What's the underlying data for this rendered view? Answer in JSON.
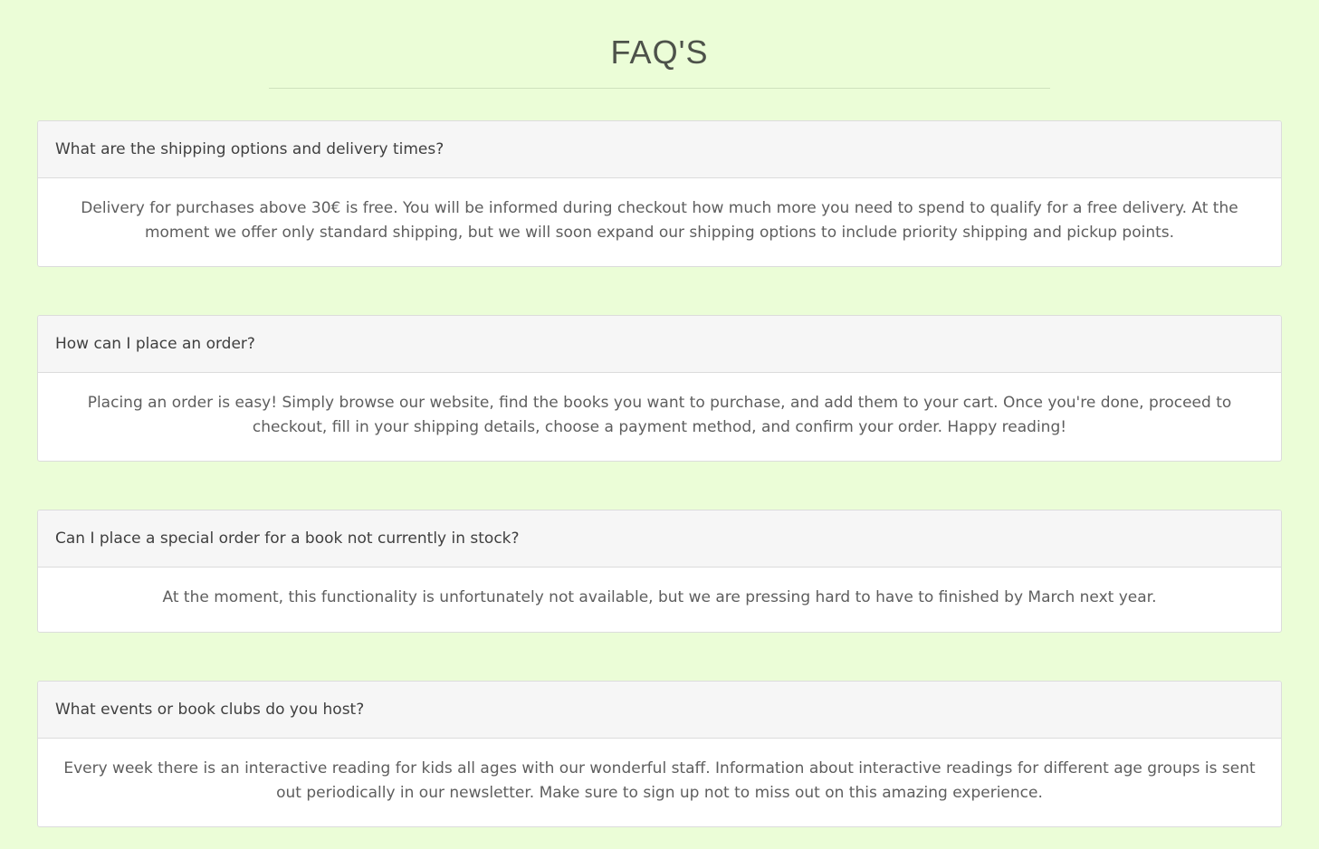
{
  "page": {
    "title": "FAQ'S"
  },
  "faqs": [
    {
      "question": "What are the shipping options and delivery times?",
      "answer": "Delivery for purchases above 30€ is free. You will be informed during checkout how much more you need to spend to qualify for a free delivery. At the moment we offer only standard shipping, but we will soon expand our shipping options to include priority shipping and pickup points."
    },
    {
      "question": "How can I place an order?",
      "answer": "Placing an order is easy! Simply browse our website, find the books you want to purchase, and add them to your cart. Once you're done, proceed to checkout, fill in your shipping details, choose a payment method, and confirm your order. Happy reading!"
    },
    {
      "question": "Can I place a special order for a book not currently in stock?",
      "answer": "At the moment, this functionality is unfortunately not available, but we are pressing hard to have to finished by March next year."
    },
    {
      "question": "What events or book clubs do you host?",
      "answer": "Every week there is an interactive reading for kids all ages with our wonderful staff. Information about interactive readings for different age groups is sent out periodically in our newsletter. Make sure to sign up not to miss out on this amazing experience."
    }
  ],
  "colors": {
    "background": "#ebfdd7",
    "card_header": "#f6f6f6",
    "card_body": "#ffffff",
    "border": "#dcdcdc"
  }
}
